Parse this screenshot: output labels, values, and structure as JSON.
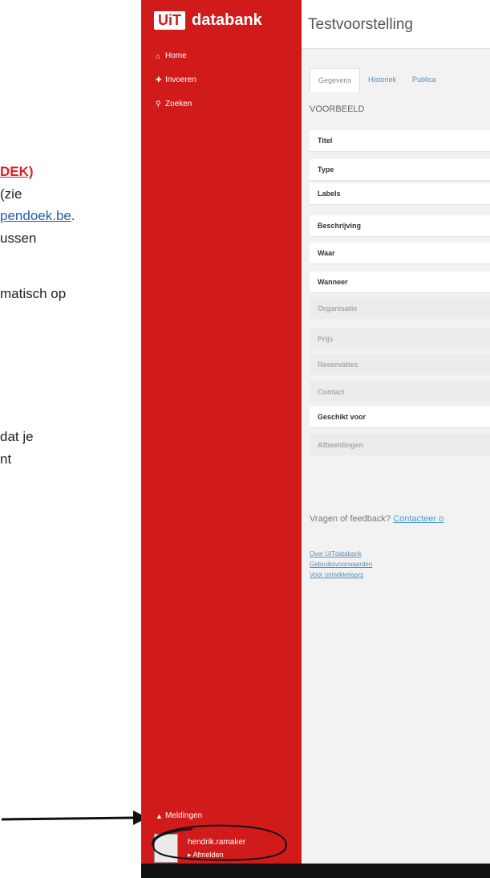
{
  "document": {
    "line1": "DEK)",
    "line2": "(zie",
    "line3_link": "pendoek.be",
    "line3_tail": ".",
    "line4": "ussen",
    "line5": "matisch op",
    "line6": "dat je",
    "line7": "nt"
  },
  "sidebar": {
    "logo_box": "UiT",
    "logo_text": "databank",
    "nav": [
      {
        "label": "Home",
        "icon": "home-icon"
      },
      {
        "label": "Invoeren",
        "icon": "plus-icon"
      },
      {
        "label": "Zoeken",
        "icon": "search-icon"
      }
    ],
    "notifications": "Meldingen",
    "user_name": "hendrik.ramaker",
    "logout": "Afmelden"
  },
  "header": {
    "title": "Testvoorstelling"
  },
  "tabs": [
    "Gegevens",
    "Historiek",
    "Publica"
  ],
  "section_title": "VOORBEELD",
  "rows": [
    {
      "label": "Titel",
      "style": "white"
    },
    {
      "label": "Type",
      "style": "white"
    },
    {
      "label": "Labels",
      "style": "white"
    },
    {
      "label": "Beschrijving",
      "style": "white"
    },
    {
      "label": "Waar",
      "style": "white"
    },
    {
      "label": "Wanneer",
      "style": "white"
    },
    {
      "label": "Organisatie",
      "style": "grey"
    },
    {
      "label": "Prijs",
      "style": "grey"
    },
    {
      "label": "Reservaties",
      "style": "grey"
    },
    {
      "label": "Contact",
      "style": "grey"
    },
    {
      "label": "Geschikt voor",
      "style": "white"
    },
    {
      "label": "Afbeeldingen",
      "style": "grey"
    }
  ],
  "feedback": {
    "text": "Vragen of feedback?",
    "link": "Contacteer o"
  },
  "footer_links": [
    "Over UiTdatabank",
    "Gebruiksvoorwaarden",
    "Voor ontwikkelaars"
  ],
  "colors": {
    "brand_red": "#d11b1b",
    "link_blue": "#5a8fb8"
  }
}
